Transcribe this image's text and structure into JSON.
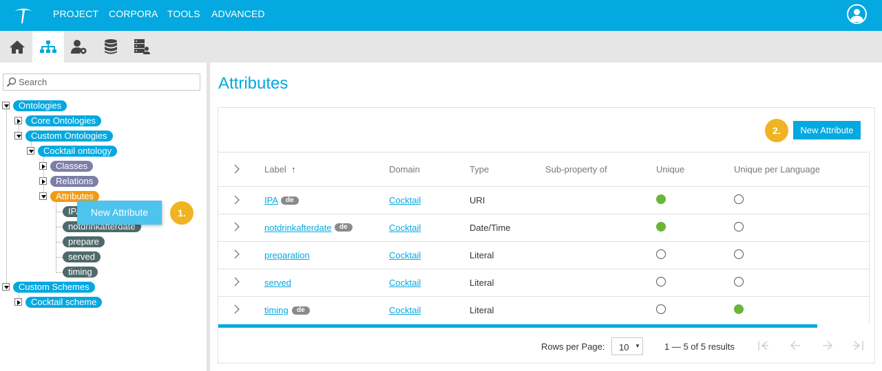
{
  "topbar": {
    "menu": [
      "PROJECT",
      "CORPORA",
      "TOOLS",
      "ADVANCED"
    ]
  },
  "iconbar": {
    "icons": [
      "home-icon",
      "hierarchy-icon",
      "user-settings-icon",
      "database-icon",
      "server-user-icon"
    ]
  },
  "sidebar": {
    "search_placeholder": "Search",
    "tree": {
      "ontologies": "Ontologies",
      "core_ontologies": "Core Ontologies",
      "custom_ontologies": "Custom Ontologies",
      "cocktail_ontology": "Cocktail ontology",
      "classes": "Classes",
      "relations": "Relations",
      "attributes": "Attributes",
      "attr_items": [
        "IPA",
        "notdrinkafterdate",
        "prepare",
        "served",
        "timing"
      ],
      "custom_schemes": "Custom Schemes",
      "cocktail_scheme": "Cocktail scheme"
    },
    "context_menu": {
      "label": "New Attribute"
    },
    "step1": "1."
  },
  "main": {
    "title": "Attributes",
    "step2": "2.",
    "new_button": "New Attribute",
    "columns": [
      "Label",
      "Domain",
      "Type",
      "Sub-property of",
      "Unique",
      "Unique per Language"
    ],
    "sort_indicator": "↑",
    "rows": [
      {
        "label": "IPA",
        "tag": "de",
        "domain": "Cocktail",
        "type": "URI",
        "unique": true,
        "unique_per_language": false
      },
      {
        "label": "notdrinkafterdate",
        "tag": "de",
        "domain": "Cocktail",
        "type": "Date/Time",
        "unique": true,
        "unique_per_language": false
      },
      {
        "label": "preparation",
        "tag": "",
        "domain": "Cocktail",
        "type": "Literal",
        "unique": false,
        "unique_per_language": false
      },
      {
        "label": "served",
        "tag": "",
        "domain": "Cocktail",
        "type": "Literal",
        "unique": false,
        "unique_per_language": false
      },
      {
        "label": "timing",
        "tag": "de",
        "domain": "Cocktail",
        "type": "Literal",
        "unique": false,
        "unique_per_language": true
      }
    ],
    "footer": {
      "rows_per_page_label": "Rows per Page:",
      "rows_per_page_value": "10",
      "results": "1 — 5 of 5 results"
    }
  },
  "colors": {
    "accent": "#03a9e0",
    "badge": "#f0b323",
    "node_purple": "#7c7fa8",
    "node_orange": "#f29b12",
    "node_slate": "#4f6a6d",
    "dot_green": "#6ab63a"
  }
}
